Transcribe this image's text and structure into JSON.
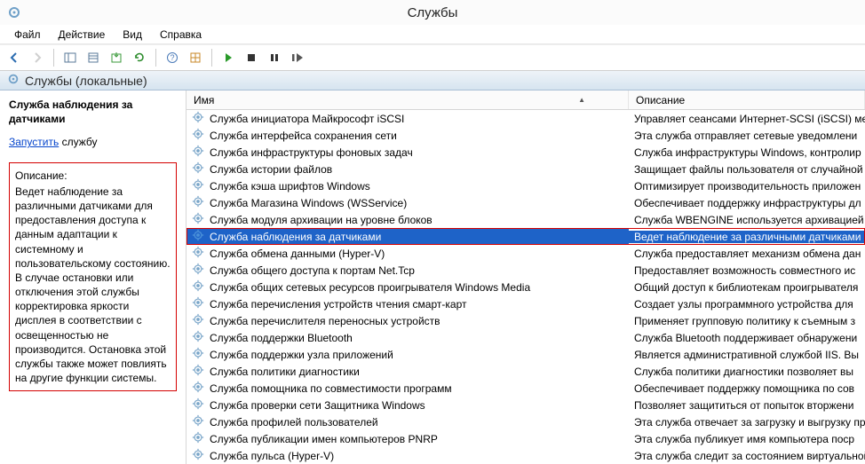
{
  "window": {
    "title": "Службы"
  },
  "menu": {
    "file": "Файл",
    "action": "Действие",
    "view": "Вид",
    "help": "Справка"
  },
  "region_tab": {
    "label": "Службы (локальные)"
  },
  "detail": {
    "selected_title": "Служба наблюдения за датчиками",
    "start_link": "Запустить",
    "start_suffix": " службу",
    "desc_label": "Описание:",
    "desc_text": "Ведет наблюдение за различными датчиками для предоставления доступа к данным адаптации к системному и пользовательскому состоянию.  В случае остановки или отключения этой службы корректировка яркости дисплея в соответствии с освещенностью не производится. Остановка этой службы также может повлиять на другие функции системы."
  },
  "columns": {
    "name": "Имя",
    "desc": "Описание"
  },
  "services": [
    {
      "name": "Служба инициатора Майкрософт iSCSI",
      "desc": "Управляет сеансами Интернет-SCSI (iSCSI) ме"
    },
    {
      "name": "Служба интерфейса сохранения сети",
      "desc": "Эта служба отправляет сетевые уведомлени"
    },
    {
      "name": "Служба инфраструктуры фоновых задач",
      "desc": "Служба инфраструктуры Windows, контролир"
    },
    {
      "name": "Служба истории файлов",
      "desc": "Защищает файлы пользователя от случайной"
    },
    {
      "name": "Служба кэша шрифтов Windows",
      "desc": "Оптимизирует производительность приложен"
    },
    {
      "name": "Служба Магазина Windows (WSService)",
      "desc": "Обеспечивает поддержку инфраструктуры дл"
    },
    {
      "name": "Служба модуля архивации на уровне блоков",
      "desc": "Служба WBENGINE используется архивацией д"
    },
    {
      "name": "Служба наблюдения за датчиками",
      "desc": "Ведет наблюдение за различными датчиками",
      "selected": true
    },
    {
      "name": "Служба обмена данными (Hyper-V)",
      "desc": "Служба предоставляет механизм обмена дан"
    },
    {
      "name": "Служба общего доступа к портам Net.Tcp",
      "desc": "Предоставляет возможность совместного ис"
    },
    {
      "name": "Служба общих сетевых ресурсов проигрывателя Windows Media",
      "desc": "Общий доступ к библиотекам проигрывателя"
    },
    {
      "name": "Служба перечисления устройств чтения смарт-карт",
      "desc": "Создает узлы программного устройства для"
    },
    {
      "name": "Служба перечислителя переносных устройств",
      "desc": "Применяет групповую политику к съемным з"
    },
    {
      "name": "Служба поддержки Bluetooth",
      "desc": "Служба Bluetooth поддерживает обнаружени"
    },
    {
      "name": "Служба поддержки узла приложений",
      "desc": "Является административной службой IIS. Вы"
    },
    {
      "name": "Служба политики диагностики",
      "desc": "Служба политики диагностики позволяет вы"
    },
    {
      "name": "Служба помощника по совместимости программ",
      "desc": "Обеспечивает поддержку помощника по сов"
    },
    {
      "name": "Служба проверки сети Защитника Windows",
      "desc": "Позволяет защититься от попыток вторжени"
    },
    {
      "name": "Служба профилей пользователей",
      "desc": "Эта служба отвечает за загрузку и выгрузку про"
    },
    {
      "name": "Служба публикации имен компьютеров PNRP",
      "desc": "Эта служба публикует имя компьютера поср"
    },
    {
      "name": "Служба пульса (Hyper-V)",
      "desc": "Эта служба следит за состоянием виртуальной"
    }
  ]
}
